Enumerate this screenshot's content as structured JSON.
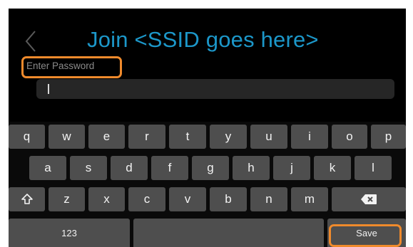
{
  "screen": {
    "title": "Join <SSID goes here>",
    "password_label": "Enter Password",
    "password_value": "",
    "accent_color": "#1c97c9",
    "highlight_color": "#ef8a2c"
  },
  "keyboard": {
    "row1": [
      "q",
      "w",
      "e",
      "r",
      "t",
      "y",
      "u",
      "i",
      "o",
      "p"
    ],
    "row2": [
      "a",
      "s",
      "d",
      "f",
      "g",
      "h",
      "j",
      "k",
      "l"
    ],
    "row3": [
      "z",
      "x",
      "c",
      "v",
      "b",
      "n",
      "m"
    ],
    "shift_icon": "shift-arrow-icon",
    "backspace_icon": "backspace-icon",
    "numbers_label": "123",
    "save_label": "Save"
  }
}
